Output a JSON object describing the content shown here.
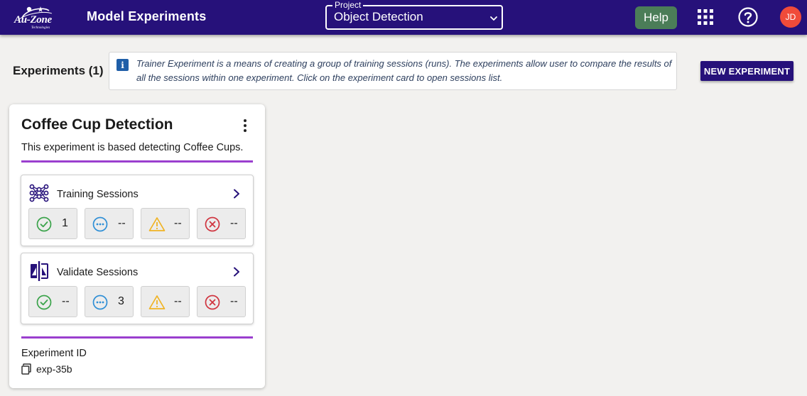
{
  "header": {
    "logo_text": "Au-Zone",
    "logo_subtext": "Technologies",
    "title": "Model Experiments",
    "project_label": "Project",
    "project_value": "Object Detection",
    "help_label": "Help",
    "avatar_initials": "JD",
    "colors": {
      "bar": "#26117a",
      "help": "#4b7d58",
      "avatar": "#f04b3a"
    }
  },
  "toolbar": {
    "experiments_count": "Experiments (1)",
    "info_text": "Trainer Experiment is a means of creating a group of training sessions (runs). The experiments allow user to compare the results of all the sessions within one experiment. Click on the experiment card to open sessions list.",
    "new_experiment_label": "NEW EXPERIMENT"
  },
  "experiment": {
    "title": "Coffee Cup Detection",
    "description": "This experiment is based detecting Coffee Cups.",
    "accent_color": "#9b3fcf",
    "training": {
      "label": "Training Sessions",
      "icon": "neural-network-icon",
      "stats": {
        "completed": "1",
        "running": "--",
        "warning": "--",
        "failed": "--"
      }
    },
    "validate": {
      "label": "Validate Sessions",
      "icon": "validate-compare-icon",
      "stats": {
        "completed": "--",
        "running": "3",
        "warning": "--",
        "failed": "--"
      }
    },
    "id_label": "Experiment ID",
    "id_value": "exp-35b"
  }
}
